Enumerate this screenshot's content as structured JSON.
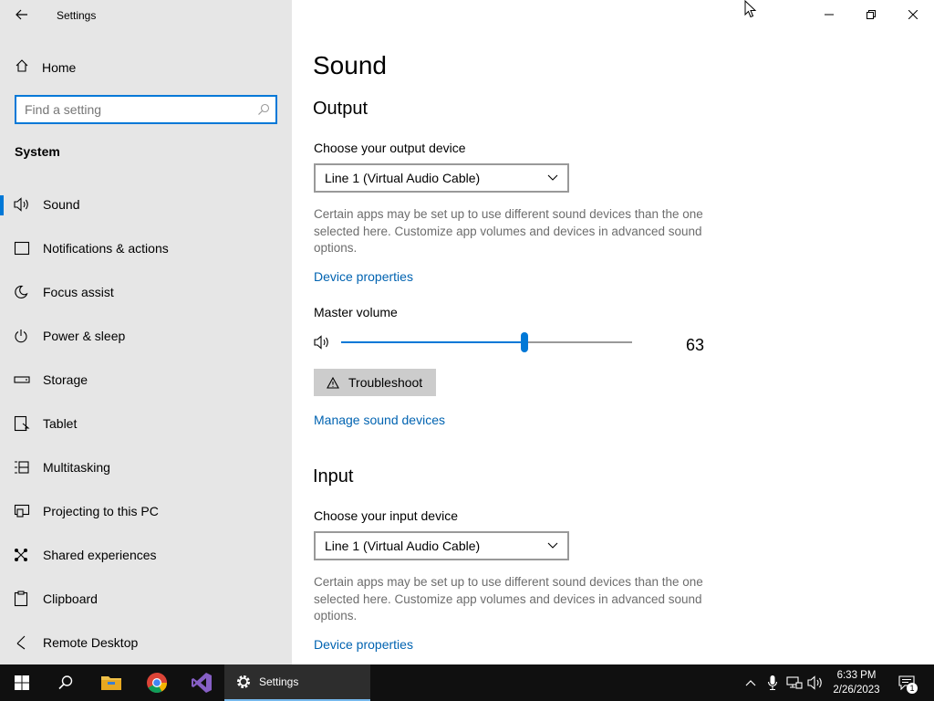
{
  "window": {
    "title": "Settings"
  },
  "sidebar": {
    "home_label": "Home",
    "search_placeholder": "Find a setting",
    "section_label": "System",
    "items": [
      {
        "label": "Sound",
        "icon": "speaker-icon",
        "active": true
      },
      {
        "label": "Notifications & actions",
        "icon": "notification-icon"
      },
      {
        "label": "Focus assist",
        "icon": "moon-icon"
      },
      {
        "label": "Power & sleep",
        "icon": "power-icon"
      },
      {
        "label": "Storage",
        "icon": "storage-icon"
      },
      {
        "label": "Tablet",
        "icon": "tablet-icon"
      },
      {
        "label": "Multitasking",
        "icon": "multitasking-icon"
      },
      {
        "label": "Projecting to this PC",
        "icon": "projecting-icon"
      },
      {
        "label": "Shared experiences",
        "icon": "shared-icon"
      },
      {
        "label": "Clipboard",
        "icon": "clipboard-icon"
      },
      {
        "label": "Remote Desktop",
        "icon": "remote-desktop-icon"
      }
    ]
  },
  "main": {
    "title": "Sound",
    "output": {
      "heading": "Output",
      "device_label": "Choose your output device",
      "device_value": "Line 1 (Virtual Audio Cable)",
      "description": "Certain apps may be set up to use different sound devices than the one selected here. Customize app volumes and devices in advanced sound options.",
      "device_properties": "Device properties",
      "volume_label": "Master volume",
      "volume_value": 63,
      "troubleshoot_label": "Troubleshoot",
      "manage_devices": "Manage sound devices"
    },
    "input": {
      "heading": "Input",
      "device_label": "Choose your input device",
      "device_value": "Line 1 (Virtual Audio Cable)",
      "description": "Certain apps may be set up to use different sound devices than the one selected here. Customize app volumes and devices in advanced sound options.",
      "device_properties": "Device properties"
    }
  },
  "taskbar": {
    "active_app_label": "Settings",
    "time": "6:33 PM",
    "date": "2/26/2023",
    "notification_count": "1"
  },
  "colors": {
    "accent": "#0078d7",
    "link": "#0063b1",
    "sidebar_bg": "#e6e6e6",
    "taskbar_bg": "#101010"
  }
}
